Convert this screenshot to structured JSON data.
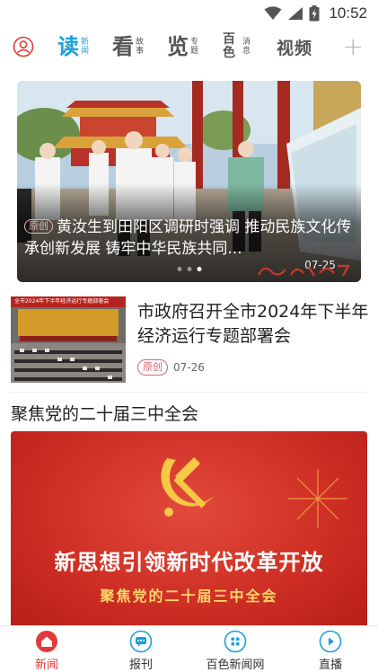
{
  "status_bar": {
    "time": "10:52"
  },
  "nav": {
    "tabs": [
      {
        "big": "读",
        "small1": "新",
        "small2": "闻"
      },
      {
        "big": "看",
        "small1": "故",
        "small2": "事"
      },
      {
        "big": "览",
        "small1": "专",
        "small2": "题"
      },
      {
        "big": "百色",
        "small1": "消",
        "small2": "息"
      },
      {
        "label": "视频"
      }
    ]
  },
  "carousel": {
    "badge": "原创",
    "title": "黄汝生到田阳区调研时强调 推动民族文化传承创新发展 铸牢中华民族共同...",
    "date": "07-25",
    "slide_count": 3,
    "active_slide": 3
  },
  "news_items": [
    {
      "title": "市政府召开全市2024年下半年经济运行专题部署会",
      "badge": "原创",
      "date": "07-26",
      "thumb_banner": "全市2024年下半年经济运行专题部署会"
    }
  ],
  "section": {
    "title": "聚焦党的二十届三中全会",
    "banner_line1": "新思想引领新时代改革开放",
    "banner_line2": "聚焦党的二十届三中全会"
  },
  "bottom_nav": [
    {
      "label": "新闻",
      "icon": "home-icon",
      "active": true
    },
    {
      "label": "报刊",
      "icon": "chat-icon",
      "active": false
    },
    {
      "label": "百色新闻网",
      "icon": "grid-icon",
      "active": false
    },
    {
      "label": "直播",
      "icon": "play-icon",
      "active": false
    }
  ],
  "colors": {
    "accent_blue": "#1aa0d8",
    "accent_red": "#e23a3a",
    "badge_red": "#d6656b",
    "banner_red": "#cf2f24"
  }
}
